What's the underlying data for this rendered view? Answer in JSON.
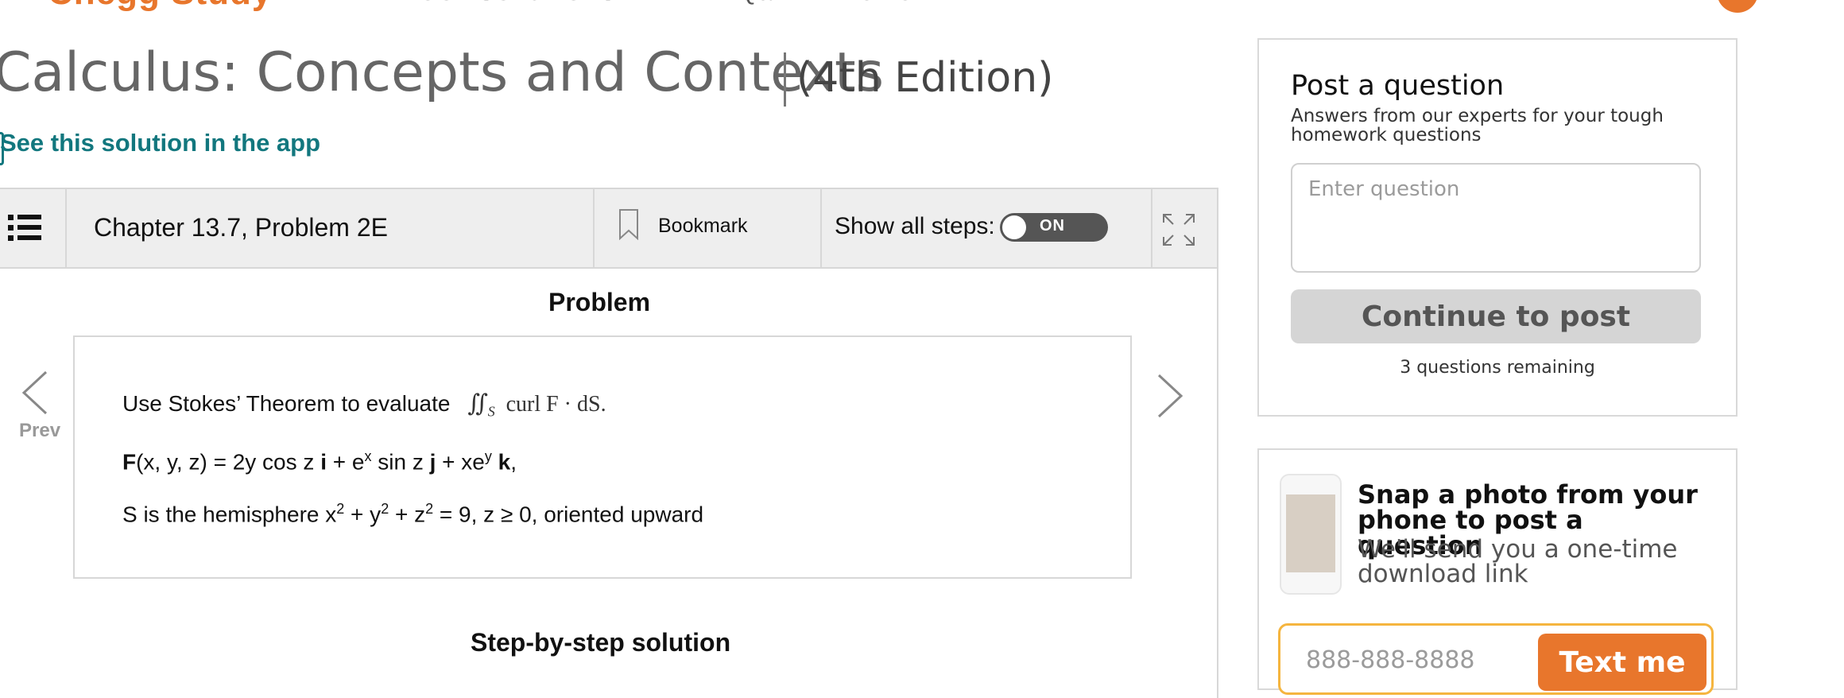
{
  "header": {
    "brand": "Chegg Study",
    "subtitle": "TEXTBOOK SOLUTIONS · EXPERT Q&A · PRACTICE"
  },
  "book": {
    "title": "Calculus: Concepts and Contexts",
    "edition": "(4th Edition)",
    "app_link": "See this solution in the app"
  },
  "toolbar": {
    "chapter": "Chapter 13.7, Problem 2E",
    "bookmark_label": "Bookmark",
    "show_steps_label": "Show all steps:",
    "toggle_state": "ON"
  },
  "problem": {
    "heading": "Problem",
    "intro": "Use Stokes’ Theorem to evaluate",
    "integral": "∬",
    "integral_sub": "S",
    "integrand": "curl F · dS.",
    "field_line": {
      "lhs_bold": "F",
      "lhs_args": "(x, y, z) = 2y cos z ",
      "i": "i",
      "plus1": " + e",
      "exp1": "x",
      "mid": " sin z ",
      "j": "j",
      "plus2": " + xe",
      "exp2": "y",
      "k": "k",
      "end": ","
    },
    "surface_line": {
      "text1": "S is the hemisphere x",
      "sq1": "2",
      "text2": " + y",
      "sq2": "2",
      "text3": " + z",
      "sq3": "2",
      "text4": " = 9, z ≥ 0, oriented upward"
    },
    "prev_label": "Prev"
  },
  "solution": {
    "heading": "Step-by-step solution"
  },
  "post": {
    "title": "Post a question",
    "subtitle": "Answers from our experts for your tough homework questions",
    "placeholder": "Enter question",
    "button": "Continue to post",
    "remaining": "3 questions remaining"
  },
  "snap": {
    "title": "Snap a photo from your phone to post a question",
    "subtitle": "We'll send you a one-time download link",
    "phone_placeholder": "888-888-8888",
    "button": "Text me"
  },
  "colors": {
    "brand_orange": "#e8762c",
    "link_teal": "#12777e",
    "field_border": "#f5b53f"
  },
  "icons": [
    "list-icon",
    "bookmark-icon",
    "expand-icon",
    "chevron-left-icon",
    "chevron-right-icon",
    "phone-icon",
    "external-link-icon"
  ]
}
